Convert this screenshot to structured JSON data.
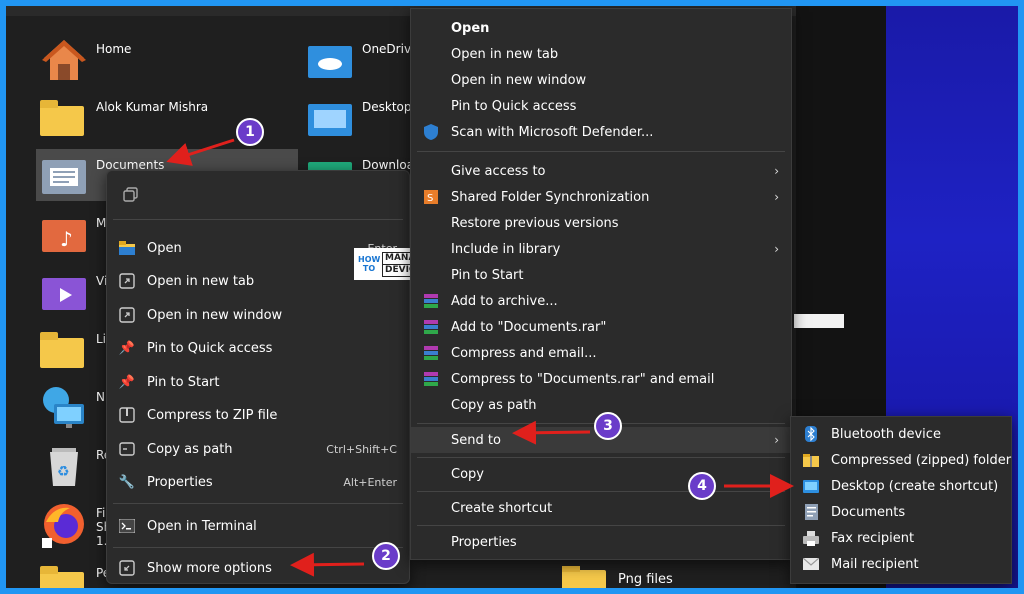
{
  "desktop": {
    "left_items": [
      {
        "label": "Home",
        "icon": "home-icon"
      },
      {
        "label": "Alok Kumar Mishra",
        "icon": "user-folder-icon"
      },
      {
        "label": "Documents",
        "icon": "documents-folder-icon"
      },
      {
        "label": "M",
        "icon": "music-folder-icon"
      },
      {
        "label": "Vi",
        "icon": "videos-folder-icon"
      },
      {
        "label": "Li",
        "icon": "folder-icon"
      },
      {
        "label": "N",
        "icon": "network-icon"
      },
      {
        "label": "Re",
        "icon": "recycle-bin-icon"
      },
      {
        "label": "Fi",
        "icon": "firefox-icon",
        "extra": [
          "Sh",
          "1."
        ]
      },
      {
        "label": "Pe",
        "icon": "folder-icon"
      }
    ],
    "right_items": [
      {
        "label": "OneDrive",
        "icon": "onedrive-folder-icon"
      },
      {
        "label": "Desktop",
        "icon": "desktop-folder-icon"
      },
      {
        "label": "Downloa",
        "icon": "downloads-folder-icon"
      }
    ],
    "png_files_label": "Png files"
  },
  "context_menu_new": {
    "items": [
      {
        "label": "Open",
        "shortcut": "Enter",
        "icon": "folder-open-icon"
      },
      {
        "label": "Open in new tab",
        "shortcut": "",
        "icon": "new-tab-icon"
      },
      {
        "label": "Open in new window",
        "shortcut": "",
        "icon": "new-window-icon"
      },
      {
        "label": "Pin to Quick access",
        "shortcut": "",
        "icon": "pin-icon"
      },
      {
        "label": "Pin to Start",
        "shortcut": "",
        "icon": "pin-icon"
      },
      {
        "label": "Compress to ZIP file",
        "shortcut": "",
        "icon": "zip-icon"
      },
      {
        "label": "Copy as path",
        "shortcut": "Ctrl+Shift+C",
        "icon": "copy-path-icon"
      },
      {
        "label": "Properties",
        "shortcut": "Alt+Enter",
        "icon": "wrench-icon"
      }
    ],
    "terminal": {
      "label": "Open in Terminal"
    },
    "more": {
      "label": "Show more options"
    }
  },
  "context_menu_classic": {
    "items": [
      {
        "label": "Open",
        "bold": true
      },
      {
        "label": "Open in new tab"
      },
      {
        "label": "Open in new window"
      },
      {
        "label": "Pin to Quick access"
      },
      {
        "label": "Scan with Microsoft Defender...",
        "icon": "shield-icon"
      }
    ],
    "items2": [
      {
        "label": "Give access to",
        "sub": true
      },
      {
        "label": "Shared Folder Synchronization",
        "sub": true,
        "icon": "sync-icon"
      },
      {
        "label": "Restore previous versions"
      },
      {
        "label": "Include in library",
        "sub": true
      },
      {
        "label": "Pin to Start"
      },
      {
        "label": "Add to archive...",
        "icon": "winrar-icon"
      },
      {
        "label": "Add to \"Documents.rar\"",
        "icon": "winrar-icon"
      },
      {
        "label": "Compress and email...",
        "icon": "winrar-icon"
      },
      {
        "label": "Compress to \"Documents.rar\" and email",
        "icon": "winrar-icon"
      },
      {
        "label": "Copy as path"
      }
    ],
    "send_to": {
      "label": "Send to"
    },
    "items3": [
      {
        "label": "Copy"
      },
      {
        "label": "Create shortcut"
      }
    ],
    "properties": {
      "label": "Properties"
    }
  },
  "send_to_menu": {
    "items": [
      {
        "label": "Bluetooth device",
        "icon": "bluetooth-icon"
      },
      {
        "label": "Compressed (zipped) folder",
        "icon": "zip-folder-icon"
      },
      {
        "label": "Desktop (create shortcut)",
        "icon": "desktop-icon"
      },
      {
        "label": "Documents",
        "icon": "documents-icon"
      },
      {
        "label": "Fax recipient",
        "icon": "fax-icon"
      },
      {
        "label": "Mail recipient",
        "icon": "mail-icon"
      }
    ]
  },
  "badges": [
    "1",
    "2",
    "3",
    "4"
  ],
  "logo": {
    "how": "HOW TO",
    "manage": "MANAGE",
    "devices": "DEVICES"
  }
}
